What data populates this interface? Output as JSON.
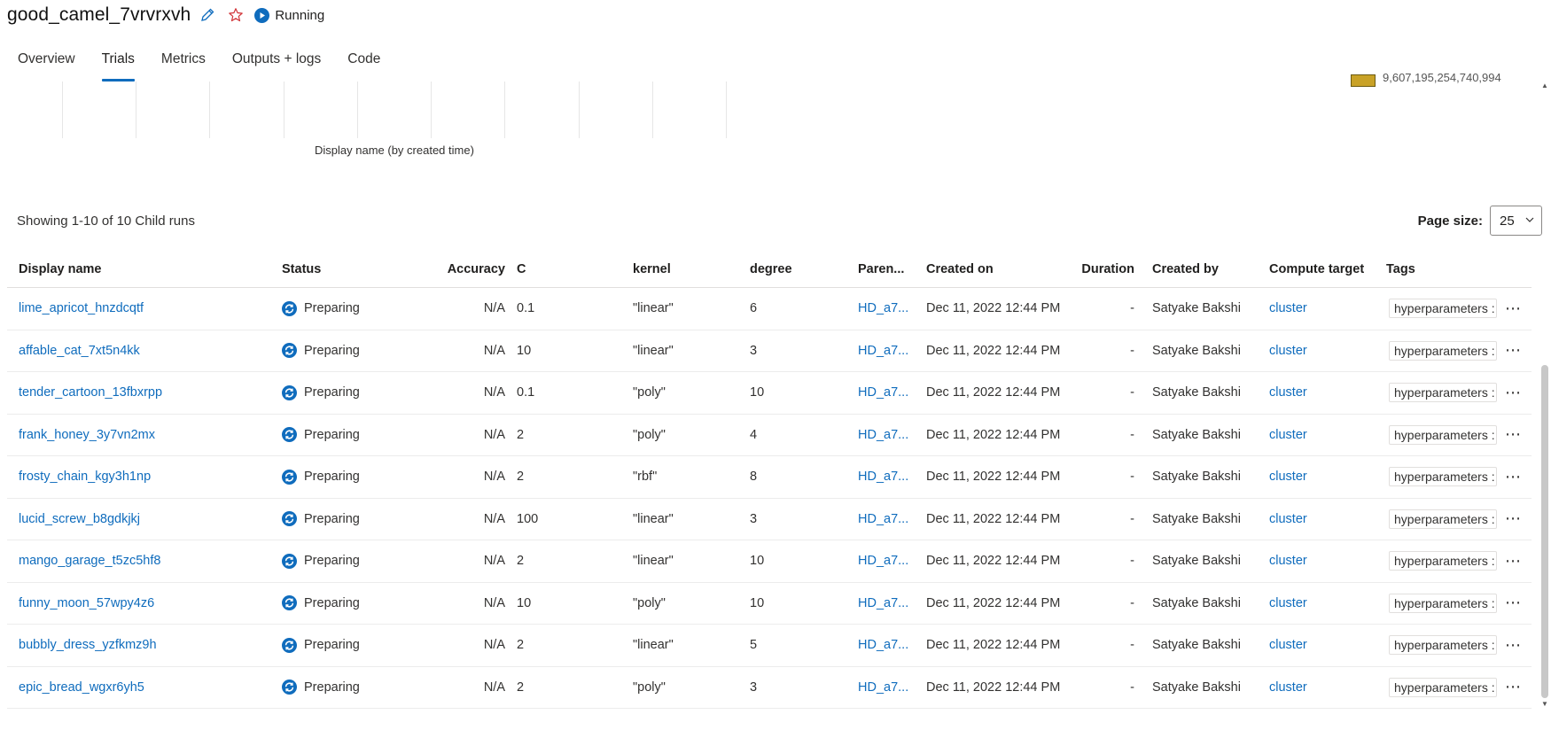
{
  "header": {
    "title": "good_camel_7vrvrxvh",
    "status": "Running",
    "colors": {
      "accent": "#0f6cbd",
      "star": "#d13438"
    }
  },
  "tabs": [
    {
      "label": "Overview"
    },
    {
      "label": "Trials"
    },
    {
      "label": "Metrics"
    },
    {
      "label": "Outputs + logs"
    },
    {
      "label": "Code"
    }
  ],
  "chart": {
    "xlabel": "Display name (by created time)",
    "legend_value": "9,607,195,254,740,994"
  },
  "summary": "Showing 1-10 of 10 Child runs",
  "page_size": {
    "label": "Page size:",
    "value": "25"
  },
  "columns": {
    "display_name": "Display name",
    "status": "Status",
    "accuracy": "Accuracy",
    "c": "C",
    "kernel": "kernel",
    "degree": "degree",
    "parent": "Paren...",
    "created_on": "Created on",
    "duration": "Duration",
    "created_by": "Created by",
    "compute_target": "Compute target",
    "tags": "Tags"
  },
  "rows": [
    {
      "name": "lime_apricot_hnzdcqtf",
      "status": "Preparing",
      "accuracy": "N/A",
      "c": "0.1",
      "kernel": "\"linear\"",
      "degree": "6",
      "parent": "HD_a7...",
      "created_on": "Dec 11, 2022 12:44 PM",
      "duration": "-",
      "created_by": "Satyake Bakshi",
      "compute": "cluster",
      "tag": "hyperparameters :"
    },
    {
      "name": "affable_cat_7xt5n4kk",
      "status": "Preparing",
      "accuracy": "N/A",
      "c": "10",
      "kernel": "\"linear\"",
      "degree": "3",
      "parent": "HD_a7...",
      "created_on": "Dec 11, 2022 12:44 PM",
      "duration": "-",
      "created_by": "Satyake Bakshi",
      "compute": "cluster",
      "tag": "hyperparameters :"
    },
    {
      "name": "tender_cartoon_13fbxrpp",
      "status": "Preparing",
      "accuracy": "N/A",
      "c": "0.1",
      "kernel": "\"poly\"",
      "degree": "10",
      "parent": "HD_a7...",
      "created_on": "Dec 11, 2022 12:44 PM",
      "duration": "-",
      "created_by": "Satyake Bakshi",
      "compute": "cluster",
      "tag": "hyperparameters :"
    },
    {
      "name": "frank_honey_3y7vn2mx",
      "status": "Preparing",
      "accuracy": "N/A",
      "c": "2",
      "kernel": "\"poly\"",
      "degree": "4",
      "parent": "HD_a7...",
      "created_on": "Dec 11, 2022 12:44 PM",
      "duration": "-",
      "created_by": "Satyake Bakshi",
      "compute": "cluster",
      "tag": "hyperparameters :"
    },
    {
      "name": "frosty_chain_kgy3h1np",
      "status": "Preparing",
      "accuracy": "N/A",
      "c": "2",
      "kernel": "\"rbf\"",
      "degree": "8",
      "parent": "HD_a7...",
      "created_on": "Dec 11, 2022 12:44 PM",
      "duration": "-",
      "created_by": "Satyake Bakshi",
      "compute": "cluster",
      "tag": "hyperparameters :"
    },
    {
      "name": "lucid_screw_b8gdkjkj",
      "status": "Preparing",
      "accuracy": "N/A",
      "c": "100",
      "kernel": "\"linear\"",
      "degree": "3",
      "parent": "HD_a7...",
      "created_on": "Dec 11, 2022 12:44 PM",
      "duration": "-",
      "created_by": "Satyake Bakshi",
      "compute": "cluster",
      "tag": "hyperparameters :"
    },
    {
      "name": "mango_garage_t5zc5hf8",
      "status": "Preparing",
      "accuracy": "N/A",
      "c": "2",
      "kernel": "\"linear\"",
      "degree": "10",
      "parent": "HD_a7...",
      "created_on": "Dec 11, 2022 12:44 PM",
      "duration": "-",
      "created_by": "Satyake Bakshi",
      "compute": "cluster",
      "tag": "hyperparameters :"
    },
    {
      "name": "funny_moon_57wpy4z6",
      "status": "Preparing",
      "accuracy": "N/A",
      "c": "10",
      "kernel": "\"poly\"",
      "degree": "10",
      "parent": "HD_a7...",
      "created_on": "Dec 11, 2022 12:44 PM",
      "duration": "-",
      "created_by": "Satyake Bakshi",
      "compute": "cluster",
      "tag": "hyperparameters :"
    },
    {
      "name": "bubbly_dress_yzfkmz9h",
      "status": "Preparing",
      "accuracy": "N/A",
      "c": "2",
      "kernel": "\"linear\"",
      "degree": "5",
      "parent": "HD_a7...",
      "created_on": "Dec 11, 2022 12:44 PM",
      "duration": "-",
      "created_by": "Satyake Bakshi",
      "compute": "cluster",
      "tag": "hyperparameters :"
    },
    {
      "name": "epic_bread_wgxr6yh5",
      "status": "Preparing",
      "accuracy": "N/A",
      "c": "2",
      "kernel": "\"poly\"",
      "degree": "3",
      "parent": "HD_a7...",
      "created_on": "Dec 11, 2022 12:44 PM",
      "duration": "-",
      "created_by": "Satyake Bakshi",
      "compute": "cluster",
      "tag": "hyperparameters :"
    }
  ],
  "more_label": "⋯",
  "icons": {
    "edit": "pencil-icon",
    "favorite": "star-icon",
    "status_running": "play-circle-icon",
    "status_preparing": "sync-circle-icon",
    "dropdown": "chevron-down-icon"
  }
}
